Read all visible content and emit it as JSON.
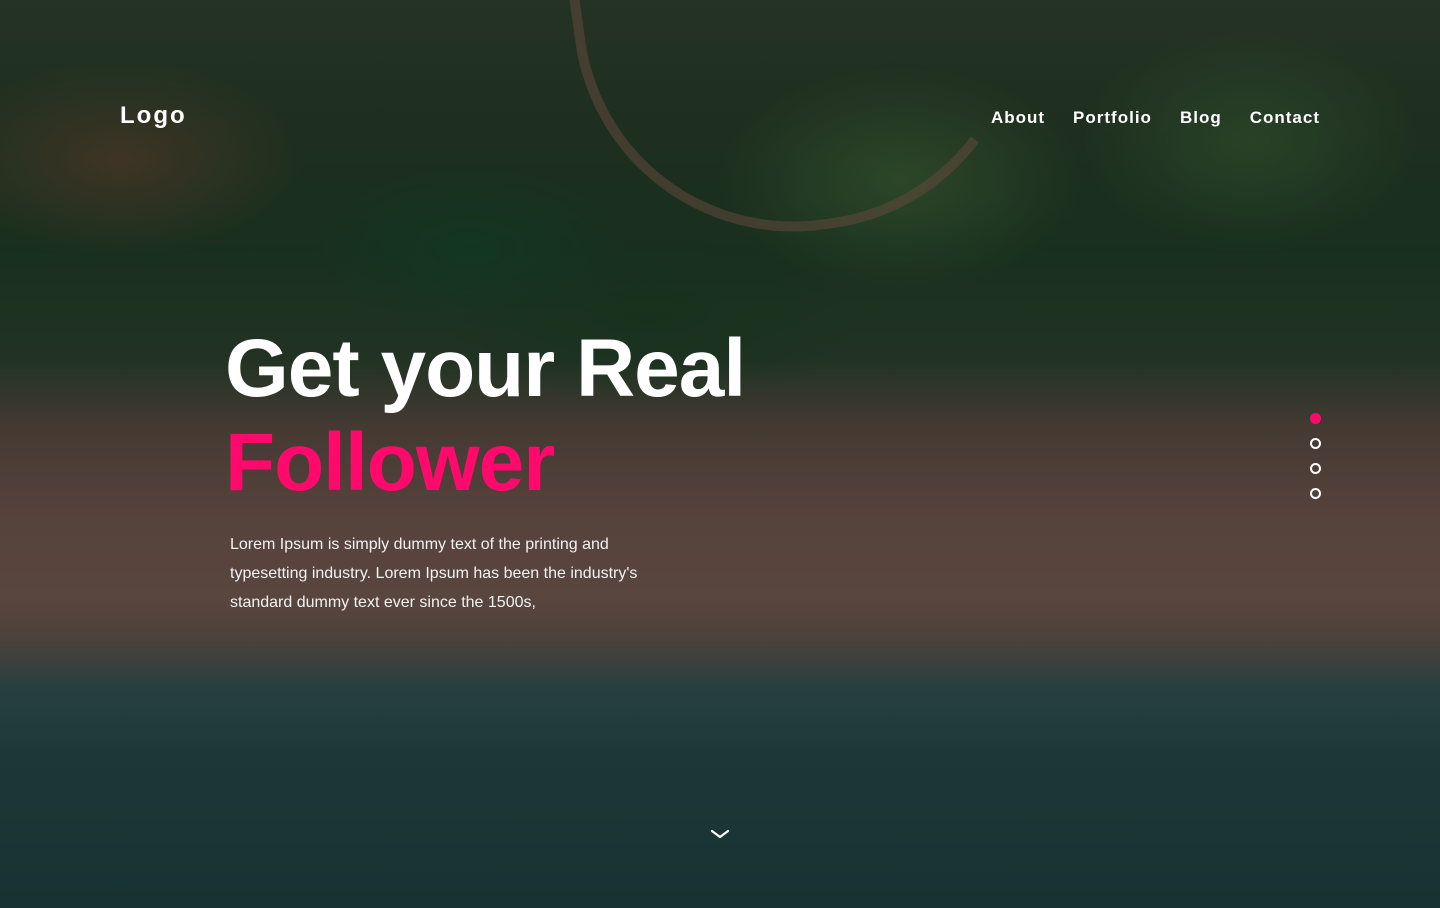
{
  "header": {
    "logo": "Logo",
    "nav": [
      {
        "label": "About"
      },
      {
        "label": "Portfolio"
      },
      {
        "label": "Blog"
      },
      {
        "label": "Contact"
      }
    ]
  },
  "hero": {
    "title_line1": "Get your Real",
    "title_line2": "Follower",
    "description": "Lorem Ipsum is simply dummy text of the printing and typesetting industry. Lorem Ipsum has been the industry's standard dummy text ever since the 1500s,"
  },
  "slider": {
    "total": 4,
    "active_index": 0
  },
  "icons": {
    "scroll": "chevron-down-icon"
  },
  "colors": {
    "accent": "#ff0a6c",
    "text": "#ffffff"
  }
}
